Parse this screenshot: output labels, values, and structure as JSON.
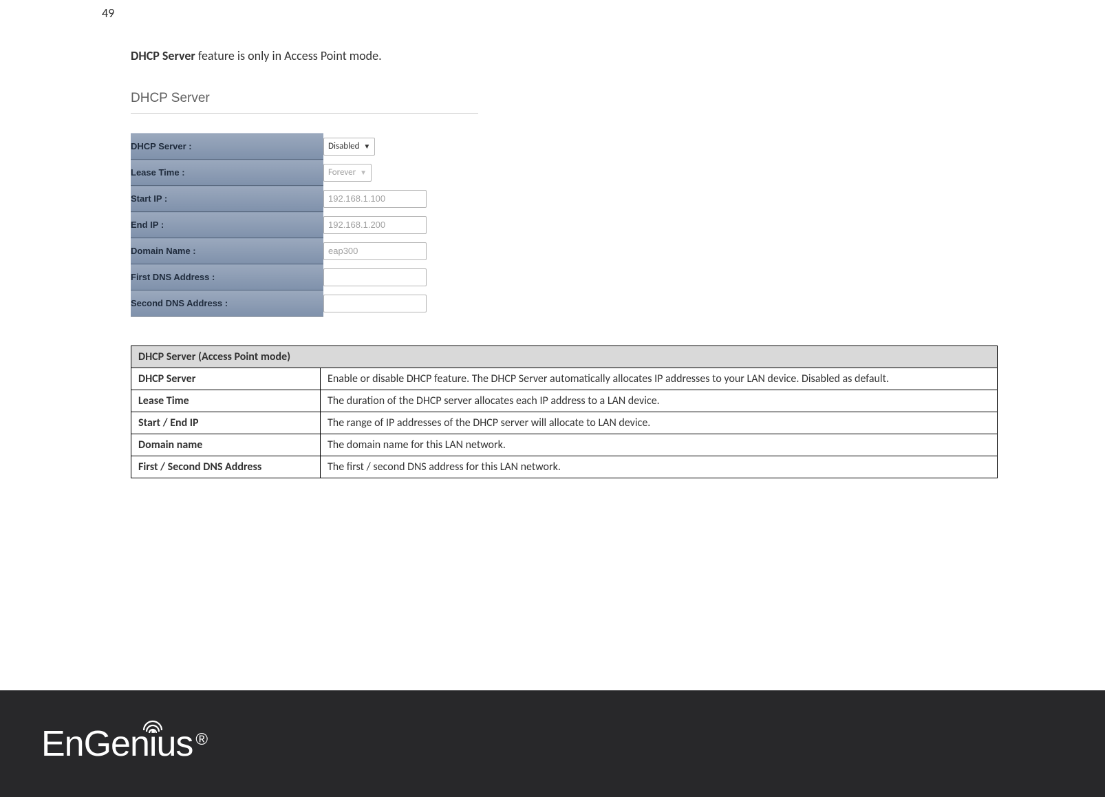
{
  "page_number": "49",
  "intro": {
    "strong": "DHCP Server",
    "rest": " feature is only in Access Point mode."
  },
  "panel": {
    "title": "DHCP Server",
    "rows": [
      {
        "label": "DHCP Server :",
        "type": "select",
        "value": "Disabled",
        "dim": false
      },
      {
        "label": "Lease Time :",
        "type": "select",
        "value": "Forever",
        "dim": true
      },
      {
        "label": "Start IP :",
        "type": "input",
        "value": "192.168.1.100",
        "dim": true
      },
      {
        "label": "End IP :",
        "type": "input",
        "value": "192.168.1.200",
        "dim": true
      },
      {
        "label": "Domain Name :",
        "type": "input",
        "value": "eap300",
        "dim": true
      },
      {
        "label": "First DNS Address :",
        "type": "input",
        "value": "",
        "dim": false
      },
      {
        "label": "Second DNS Address :",
        "type": "input",
        "value": "",
        "dim": false
      }
    ]
  },
  "desc_table": {
    "header": "DHCP Server (Access Point mode)",
    "rows": [
      {
        "name": "DHCP Server",
        "desc": "Enable or disable DHCP feature. The DHCP Server automatically allocates IP addresses to your LAN device. Disabled as default."
      },
      {
        "name": "Lease Time",
        "desc": "The duration of the DHCP server allocates each IP address to a LAN device."
      },
      {
        "name": "Start / End IP",
        "desc": "The range of IP addresses of the DHCP server will allocate to LAN device."
      },
      {
        "name": "Domain name",
        "desc": "The domain name for this LAN network."
      },
      {
        "name": "First / Second DNS Address",
        "desc": "The first / second DNS address for this LAN network."
      }
    ]
  },
  "logo": {
    "text_before_i": "EnGen",
    "i": "i",
    "text_after_i": "us",
    "reg": "®"
  }
}
